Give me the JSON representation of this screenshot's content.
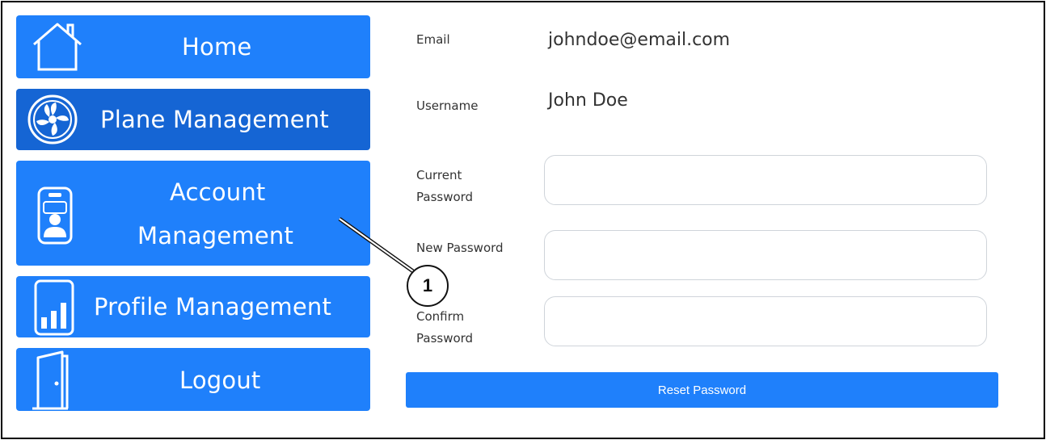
{
  "sidebar": {
    "items": [
      {
        "label": "Home",
        "icon": "house-icon"
      },
      {
        "label": "Plane Management",
        "icon": "fan-icon"
      },
      {
        "label_line1": "Account",
        "label_line2": "Management",
        "icon": "id-badge-icon"
      },
      {
        "label": "Profile Management",
        "icon": "bar-chart-icon"
      },
      {
        "label": "Logout",
        "icon": "door-icon"
      }
    ],
    "active_index": 1
  },
  "account": {
    "email_label": "Email",
    "email_value": "johndoe@email.com",
    "username_label": "Username",
    "username_value": "John Doe",
    "current_password_line1": "Current",
    "current_password_line2": "Password",
    "new_password_label": "New Password",
    "confirm_password_line1": "Confirm",
    "confirm_password_line2": "Password",
    "reset_button": "Reset Password"
  },
  "callout": {
    "number": "1"
  },
  "colors": {
    "button_blue": "#1f80fb",
    "active_blue": "#1565d4"
  }
}
